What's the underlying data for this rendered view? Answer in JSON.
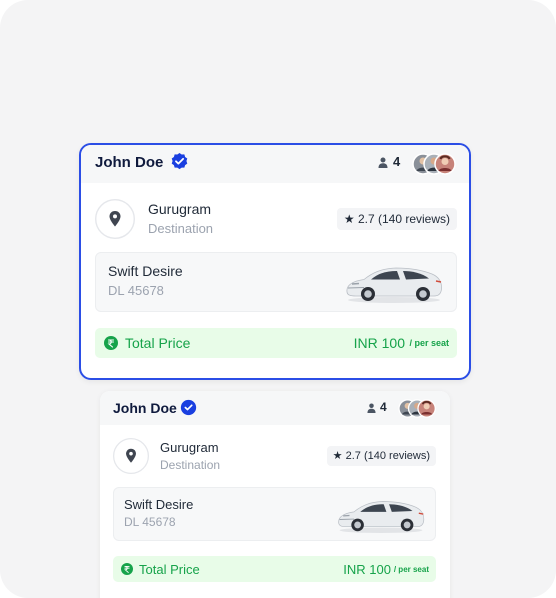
{
  "colors": {
    "accent": "#2b4ee6",
    "verified": "#1a3fe0",
    "price_green": "#16a34a",
    "price_bg": "#e8fce8",
    "panel_bg": "#f4f4f5"
  },
  "rides": [
    {
      "driver_name": "John Doe",
      "verified_icon": "verified-badge-icon",
      "seats": "4",
      "destination": "Gurugram",
      "destination_label": "Destination",
      "rating_icon": "star-icon",
      "rating": "2.7",
      "reviews": "(140 reviews)",
      "car_model": "Swift Desire",
      "car_plate": "DL 45678",
      "price_label": "Total Price",
      "price": "INR 100",
      "price_unit": "/ per seat",
      "selected": true
    },
    {
      "driver_name": "John Doe",
      "verified_icon": "verified-badge-icon",
      "seats": "4",
      "destination": "Gurugram",
      "destination_label": "Destination",
      "rating_icon": "star-icon",
      "rating": "2.7",
      "reviews": "(140 reviews)",
      "car_model": "Swift Desire",
      "car_plate": "DL 45678",
      "price_label": "Total Price",
      "price": "INR 100",
      "price_unit": "/ per seat",
      "selected": false
    }
  ]
}
